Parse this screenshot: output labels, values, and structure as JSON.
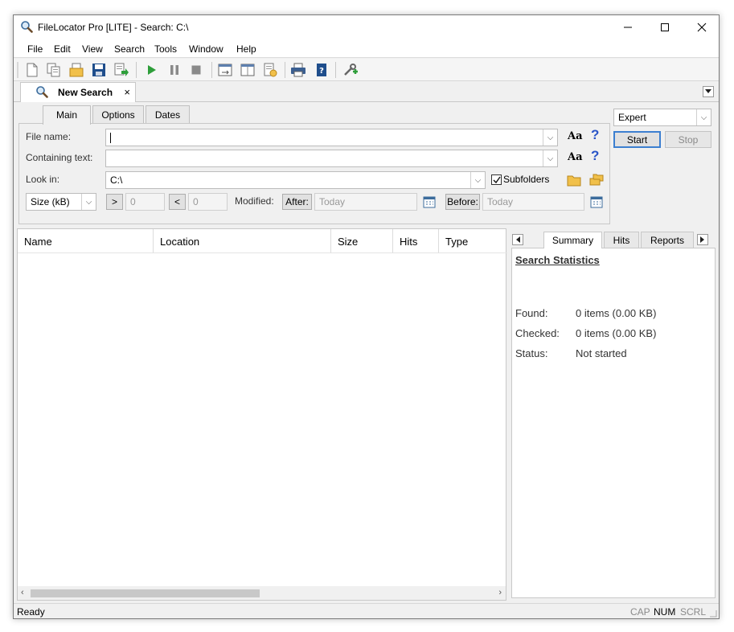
{
  "window": {
    "title": "FileLocator Pro [LITE] - Search: C:\\",
    "controls": {
      "minimize": "—",
      "maximize": "☐",
      "close": "✕"
    }
  },
  "menu": [
    "File",
    "Edit",
    "View",
    "Search",
    "Tools",
    "Window",
    "Help"
  ],
  "toolbar": {
    "icons": [
      "new-icon",
      "copy-icon",
      "open-icon",
      "save-icon",
      "export-icon",
      "play-icon",
      "pause-icon",
      "stop-icon",
      "layout-icon",
      "columns-icon",
      "settings-icon",
      "print-icon",
      "help-book-icon",
      "tools-icon"
    ]
  },
  "doc_tab": {
    "label": "New Search",
    "close": "×"
  },
  "search_tabs": [
    "Main",
    "Options",
    "Dates"
  ],
  "form": {
    "file_name_label": "File name:",
    "file_name_value": "",
    "containing_text_label": "Containing text:",
    "containing_text_value": "",
    "look_in_label": "Look in:",
    "look_in_value": "C:\\",
    "subfolders_label": "Subfolders",
    "subfolders_checked": true,
    "case_label": "Aa",
    "help_label": "?",
    "size_unit": "Size (kB)",
    "gt_label": ">",
    "gt_value": "0",
    "lt_label": "<",
    "lt_value": "0",
    "modified_label": "Modified:",
    "after_label": "After:",
    "after_value": "Today",
    "before_label": "Before:",
    "before_value": "Today"
  },
  "mode": {
    "selected": "Expert"
  },
  "actions": {
    "start": "Start",
    "stop": "Stop"
  },
  "results": {
    "columns": [
      "Name",
      "Location",
      "Size",
      "Hits",
      "Type"
    ],
    "rows": []
  },
  "stats_tabs": [
    "Summary",
    "Hits",
    "Reports"
  ],
  "stats": {
    "heading": "Search Statistics",
    "found_label": "Found:",
    "found_value": "0 items (0.00 KB)",
    "checked_label": "Checked:",
    "checked_value": "0 items (0.00 KB)",
    "status_label": "Status:",
    "status_value": "Not started"
  },
  "statusbar": {
    "text": "Ready",
    "cap": "CAP",
    "num": "NUM",
    "scrl": "SCRL"
  },
  "colors": {
    "accent": "#2a55c8",
    "play_green": "#2e9e3a",
    "window_bg": "#f0f0f0"
  }
}
